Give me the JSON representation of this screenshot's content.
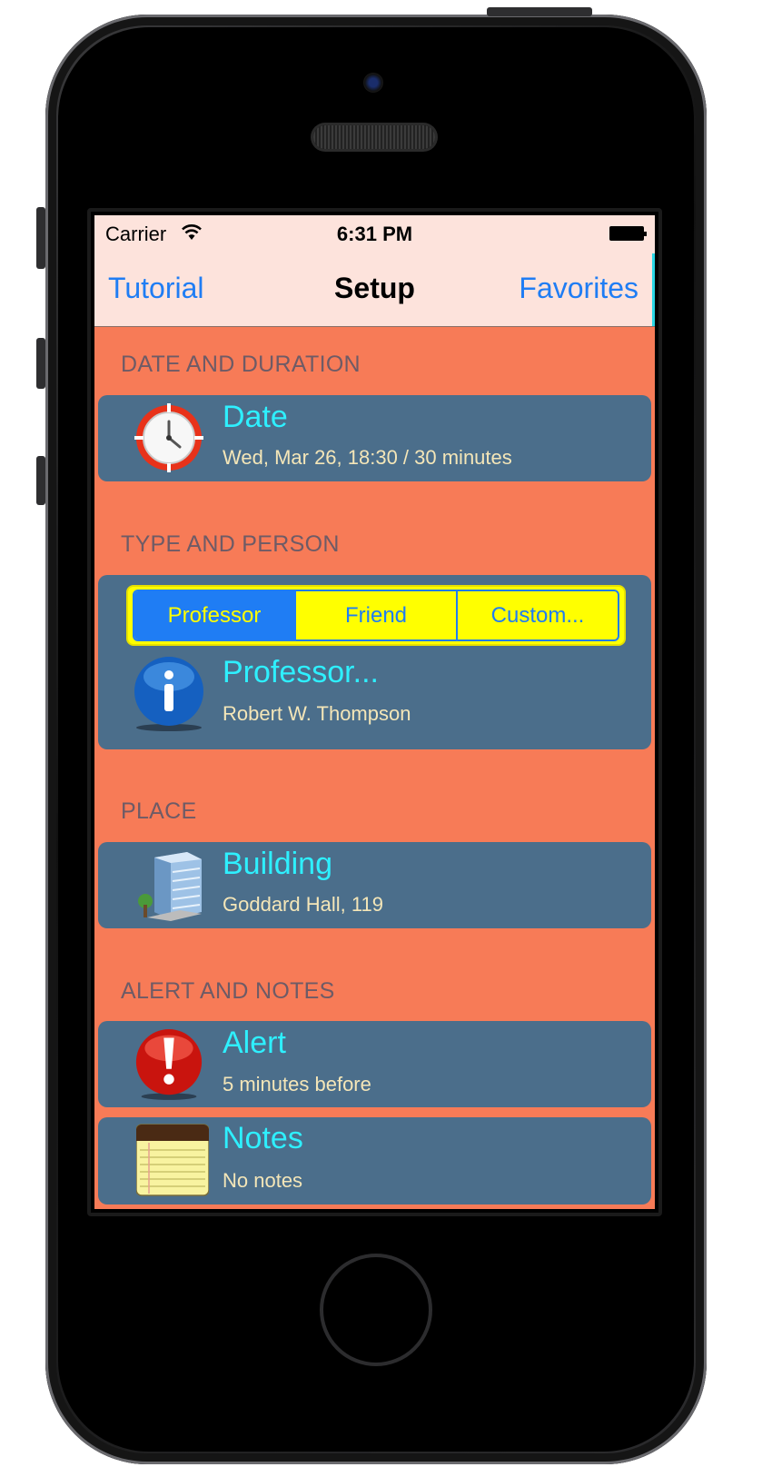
{
  "status_bar": {
    "carrier": "Carrier",
    "time": "6:31 PM"
  },
  "nav": {
    "left_button": "Tutorial",
    "title": "Setup",
    "right_button": "Favorites"
  },
  "sections": {
    "date": {
      "header": "DATE AND DURATION",
      "title": "Date",
      "subtitle": "Wed, Mar 26, 18:30 / 30 minutes",
      "icon": "clock-icon"
    },
    "type": {
      "header": "TYPE AND PERSON",
      "segments": [
        "Professor",
        "Friend",
        "Custom..."
      ],
      "selected_segment": "Professor",
      "title": "Professor...",
      "subtitle": "Robert W. Thompson",
      "icon": "info-icon"
    },
    "place": {
      "header": "PLACE",
      "title": "Building",
      "subtitle": "Goddard Hall, 119",
      "icon": "building-icon"
    },
    "alert_notes": {
      "header": "ALERT AND NOTES",
      "alert_title": "Alert",
      "alert_subtitle": "5 minutes before",
      "alert_icon": "alert-icon",
      "notes_title": "Notes",
      "notes_subtitle": "No notes",
      "notes_icon": "notepad-icon"
    }
  },
  "colors": {
    "background": "#f77b57",
    "card": "#4b6e8b",
    "title_text": "#2ef0ff",
    "subtitle_text": "#f4e6b8",
    "nav_bar": "#fde3dc",
    "accent_blue": "#1f7df4",
    "segment_yellow": "#ffff00"
  }
}
